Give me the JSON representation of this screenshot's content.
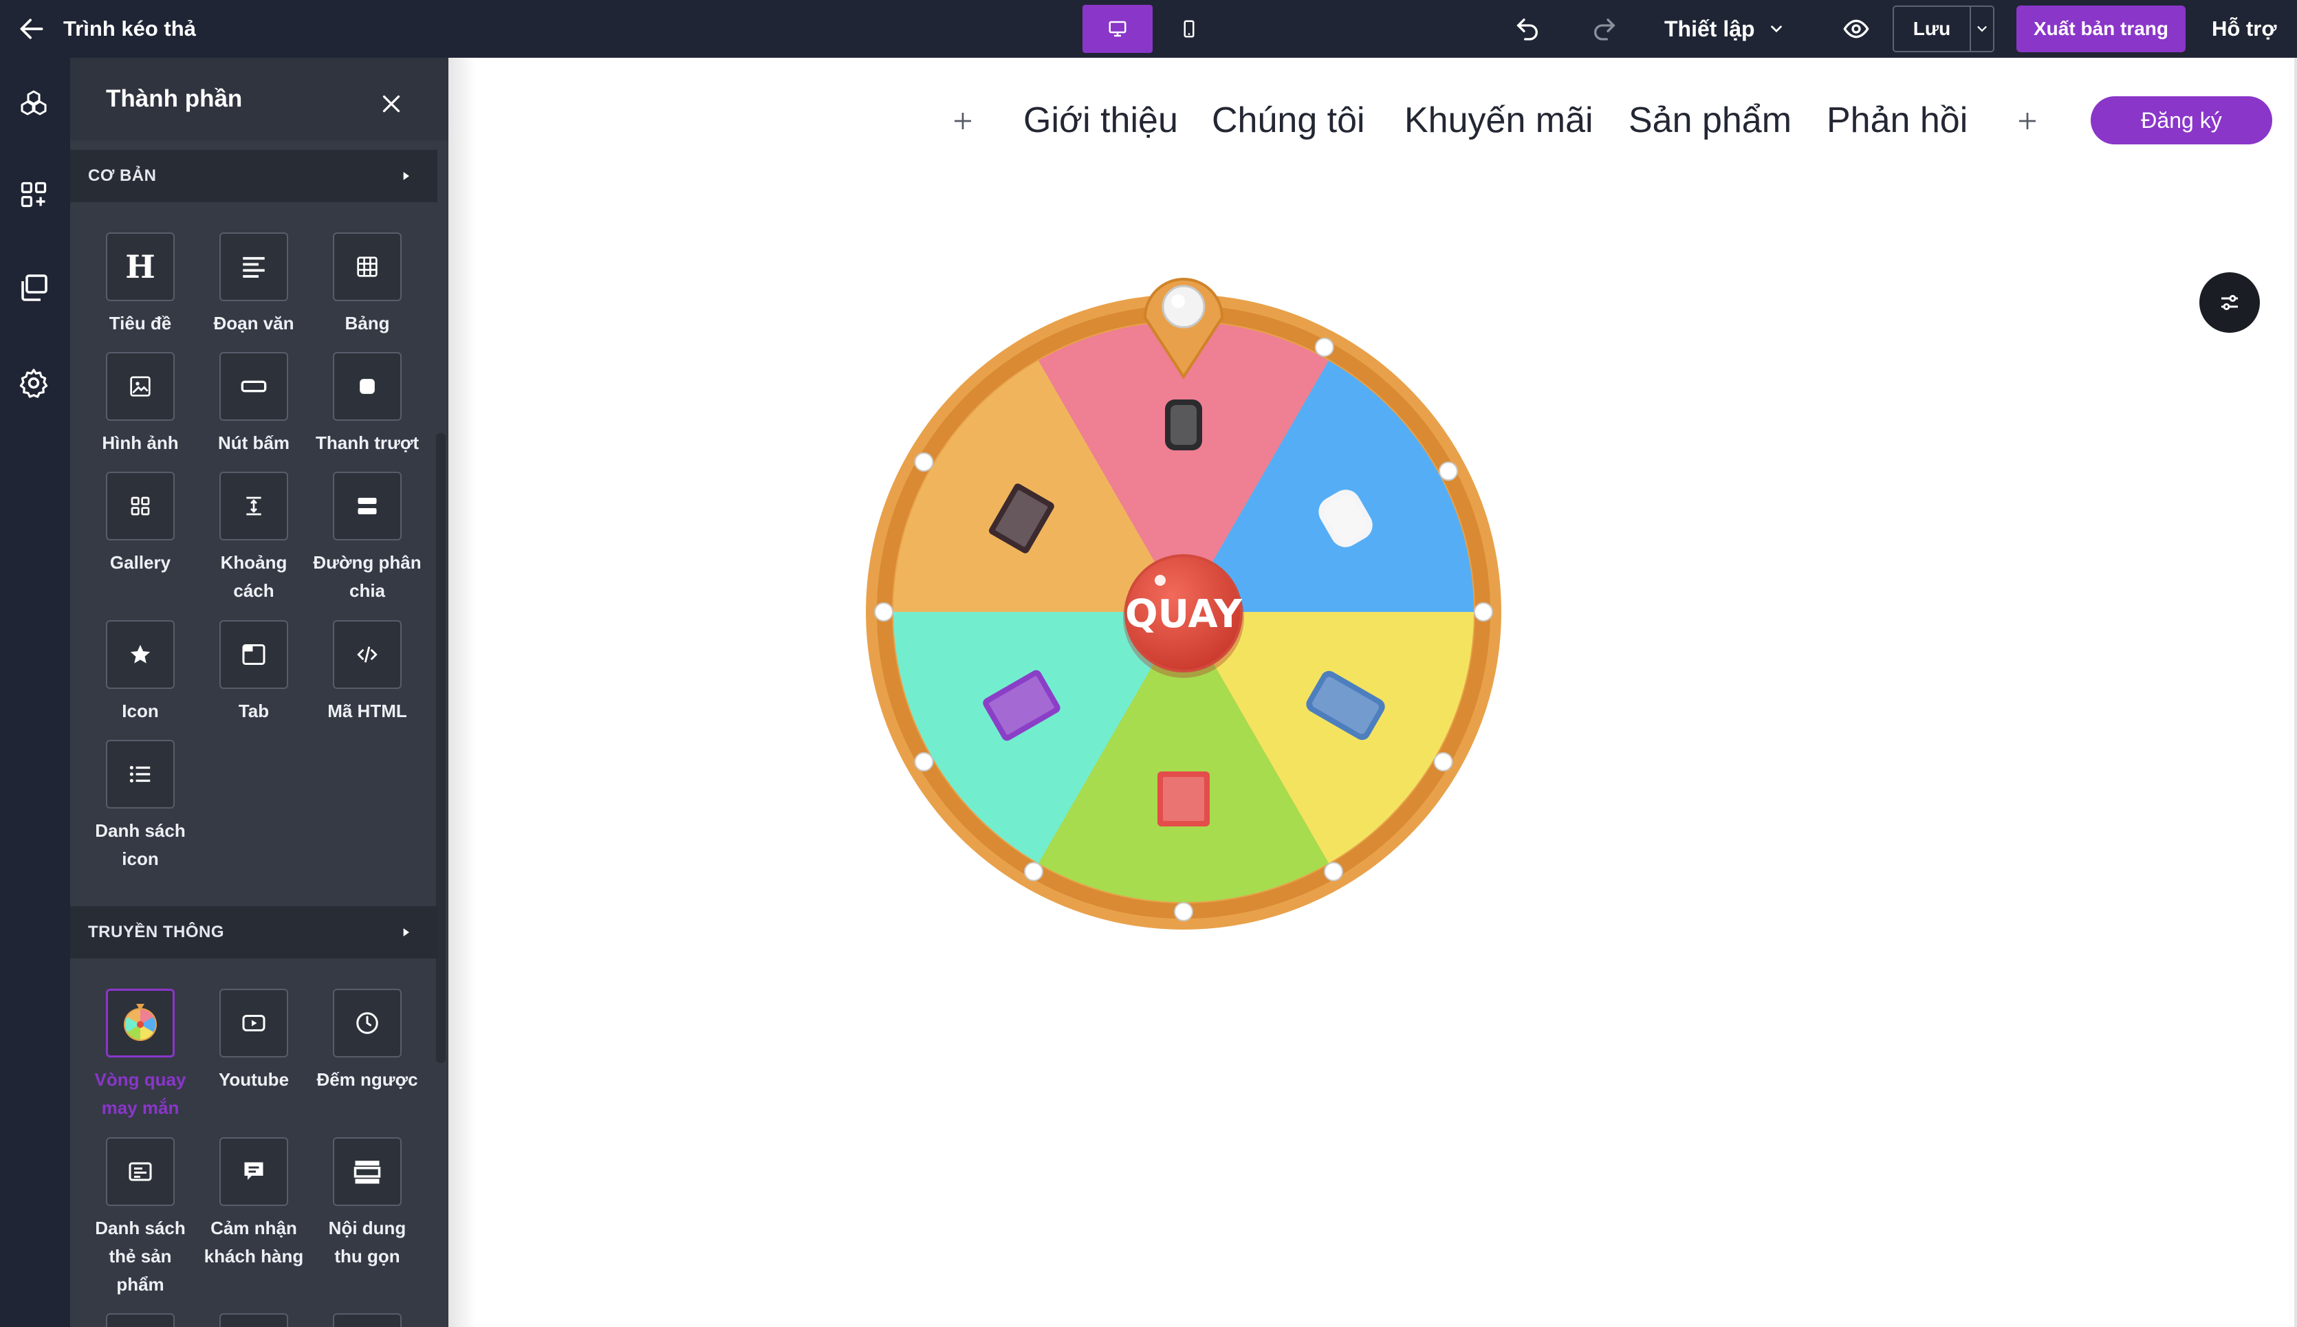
{
  "topbar": {
    "back_icon": "arrow-left-icon",
    "title": "Trình kéo thả",
    "device_desktop_icon": "desktop-icon",
    "device_mobile_icon": "mobile-icon",
    "undo_icon": "undo-icon",
    "redo_icon": "redo-icon",
    "settings_label": "Thiết lập",
    "preview_icon": "eye-icon",
    "save_label": "Lưu",
    "publish_label": "Xuất bản trang",
    "help_label": "Hỗ trợ"
  },
  "rail": {
    "icons": [
      "cubes-icon",
      "add-widget-icon",
      "pages-icon",
      "settings-gear-icon"
    ]
  },
  "panel": {
    "title": "Thành phần",
    "sections": [
      {
        "label": "CƠ BẢN",
        "items": [
          {
            "label": "Tiêu đề",
            "icon": "heading-icon"
          },
          {
            "label": "Đoạn văn",
            "icon": "paragraph-icon"
          },
          {
            "label": "Bảng",
            "icon": "table-icon"
          },
          {
            "label": "Hình ảnh",
            "icon": "image-icon"
          },
          {
            "label": "Nút bấm",
            "icon": "button-icon"
          },
          {
            "label": "Thanh trượt",
            "icon": "slider-icon"
          },
          {
            "label": "Gallery",
            "icon": "gallery-icon"
          },
          {
            "label": "Khoảng cách",
            "icon": "spacer-icon"
          },
          {
            "label": "Đường phân chia",
            "icon": "divider-icon"
          },
          {
            "label": "Icon",
            "icon": "star-icon"
          },
          {
            "label": "Tab",
            "icon": "tab-icon"
          },
          {
            "label": "Mã HTML",
            "icon": "code-icon"
          },
          {
            "label": "Danh sách icon",
            "icon": "icon-list-icon"
          }
        ]
      },
      {
        "label": "TRUYỀN THÔNG",
        "items": [
          {
            "label": "Vòng quay may mắn",
            "icon": "lucky-wheel-icon",
            "active": true
          },
          {
            "label": "Youtube",
            "icon": "youtube-icon"
          },
          {
            "label": "Đếm ngược",
            "icon": "clock-icon"
          },
          {
            "label": "Danh sách thẻ sản phẩm",
            "icon": "product-cards-icon"
          },
          {
            "label": "Cảm nhận khách hàng",
            "icon": "testimonial-icon"
          },
          {
            "label": "Nội dung thu gọn",
            "icon": "accordion-icon"
          }
        ]
      }
    ]
  },
  "canvas": {
    "nav_items": [
      "Giới thiệu",
      "Chúng tôi",
      "Khuyến mãi",
      "Sản phẩm",
      "Phản hồi"
    ],
    "cta_label": "Đăng ký",
    "fab_icon": "sliders-icon",
    "wheel": {
      "spin_label": "QUAY",
      "pointer_icon": "map-pin-icon",
      "segments": [
        {
          "color": "#ef7f93",
          "prize_icon": "smartwatch-icon"
        },
        {
          "color": "#55aef5",
          "prize_icon": "earbuds-icon"
        },
        {
          "color": "#f4e35f",
          "prize_icon": "smartphone-icon"
        },
        {
          "color": "#a7dc4f",
          "prize_icon": "gift-box-icon"
        },
        {
          "color": "#72eecf",
          "prize_icon": "tablet-icon"
        },
        {
          "color": "#f0b55c",
          "prize_icon": "laptop-icon"
        }
      ],
      "rim_color": "#e8a14a",
      "spin_color": "#e24a3b"
    }
  },
  "colors": {
    "accent": "#8a36c9",
    "topbar_bg": "#1f2534",
    "panel_bg": "#353a45"
  }
}
